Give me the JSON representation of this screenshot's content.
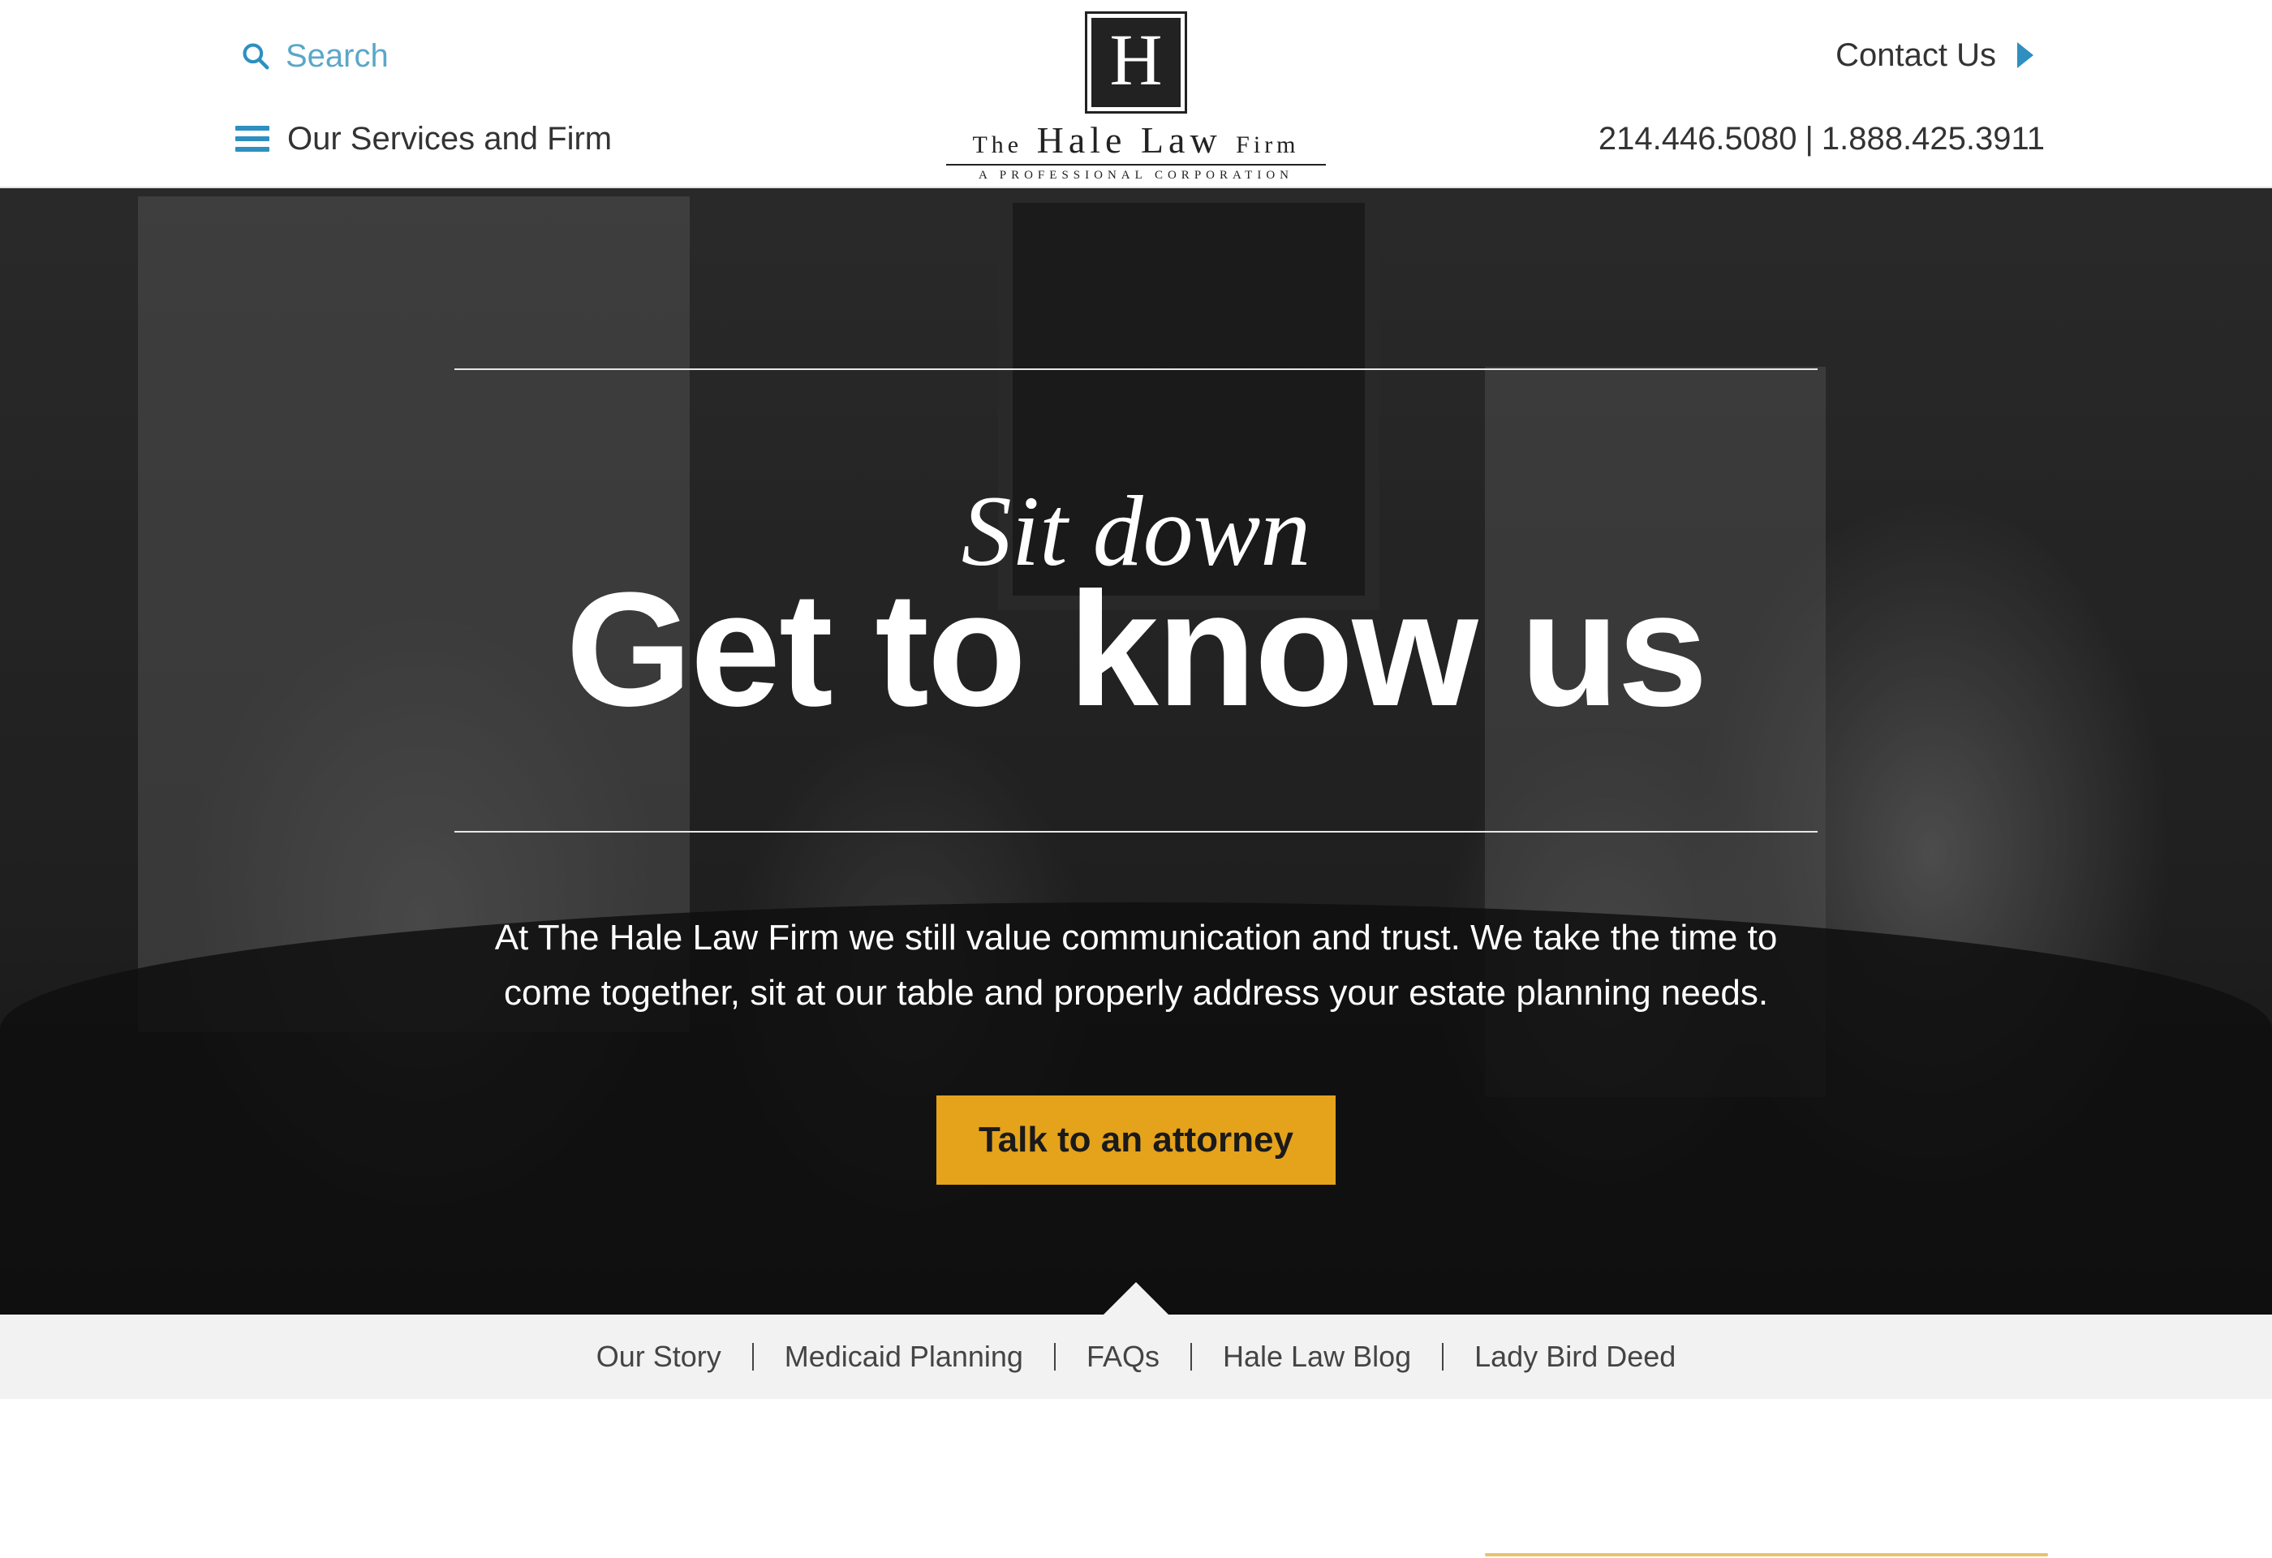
{
  "header": {
    "search_label": "Search",
    "menu_label": "Our Services and Firm",
    "contact_label": "Contact Us",
    "phone_local": "214.446.5080",
    "phone_separator": "|",
    "phone_tollfree": "1.888.425.3911",
    "logo": {
      "monogram": "H",
      "name_the": "The",
      "name_main": "Hale Law",
      "name_firm": "Firm",
      "subtitle": "A PROFESSIONAL CORPORATION"
    }
  },
  "hero": {
    "script_text": "Sit down",
    "headline": "Get to know us",
    "description": "At The Hale Law Firm we still value communication and trust. We take the time to come together, sit at our table and properly address your estate planning needs.",
    "cta_label": "Talk to an attorney"
  },
  "subnav": {
    "items": [
      {
        "label": "Our Story"
      },
      {
        "label": "Medicaid Planning"
      },
      {
        "label": "FAQs"
      },
      {
        "label": "Hale Law Blog"
      },
      {
        "label": "Lady Bird Deed"
      }
    ]
  },
  "colors": {
    "accent_blue": "#2e8fc0",
    "search_blue": "#5aa7c9",
    "cta_gold": "#e5a31b",
    "subnav_bg": "#f2f2f2"
  },
  "icons": [
    "search-icon",
    "hamburger-menu-icon",
    "play-arrow-icon"
  ]
}
